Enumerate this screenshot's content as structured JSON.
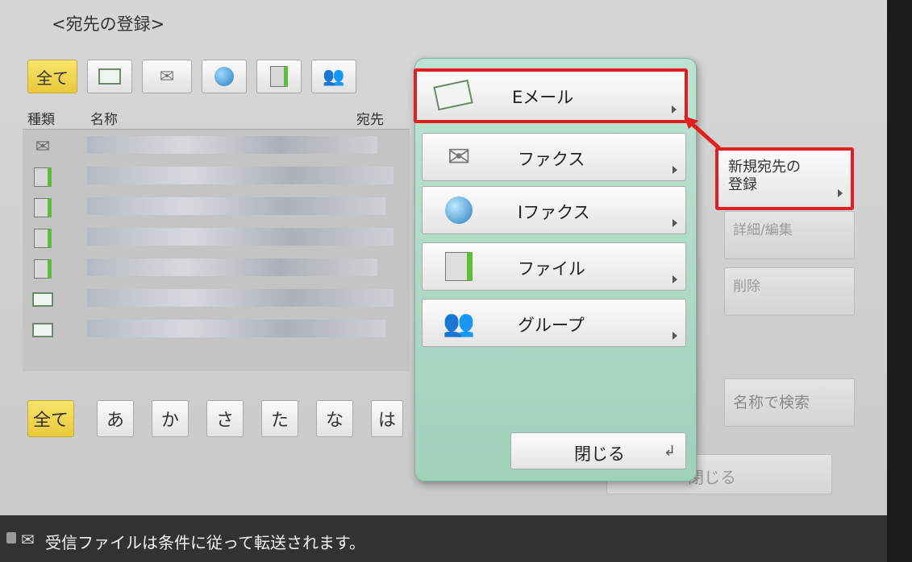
{
  "screen": {
    "title": "<宛先の登録>"
  },
  "type_filters": [
    {
      "label": "全て",
      "selected": true
    },
    {
      "icon": "email-icon"
    },
    {
      "icon": "fax-icon"
    },
    {
      "icon": "ifax-icon"
    },
    {
      "icon": "file-icon"
    },
    {
      "icon": "group-icon"
    }
  ],
  "columns": {
    "type": "種類",
    "name": "名称",
    "destination": "宛先"
  },
  "rows": [
    {
      "icon": "fax-icon"
    },
    {
      "icon": "file-icon"
    },
    {
      "icon": "file-icon"
    },
    {
      "icon": "file-icon"
    },
    {
      "icon": "file-icon"
    },
    {
      "icon": "email-icon"
    },
    {
      "icon": "email-icon"
    }
  ],
  "kana_filters": [
    "全て",
    "あ",
    "か",
    "さ",
    "た",
    "な",
    "は"
  ],
  "side_buttons": {
    "new_register": "新規宛先の\n登録",
    "details_edit": "詳細/編集",
    "delete": "削除",
    "search_by_name": "名称で検索"
  },
  "background_close": "閉じる",
  "popup": {
    "items": [
      {
        "label": "Eメール",
        "icon": "email-icon",
        "highlighted": true
      },
      {
        "label": "ファクス",
        "icon": "fax-icon",
        "highlighted": false
      },
      {
        "label": "Iファクス",
        "icon": "ifax-icon",
        "highlighted": false
      },
      {
        "label": "ファイル",
        "icon": "file-icon",
        "highlighted": false
      },
      {
        "label": "グループ",
        "icon": "group-icon",
        "highlighted": false
      }
    ],
    "close_label": "閉じる"
  },
  "status_bar": {
    "message": "受信ファイルは条件に従って転送されます。"
  },
  "colors": {
    "highlight_border": "#e02020",
    "selected_tab": "#f0d24e",
    "popup_bg": "#a8d8c3"
  }
}
